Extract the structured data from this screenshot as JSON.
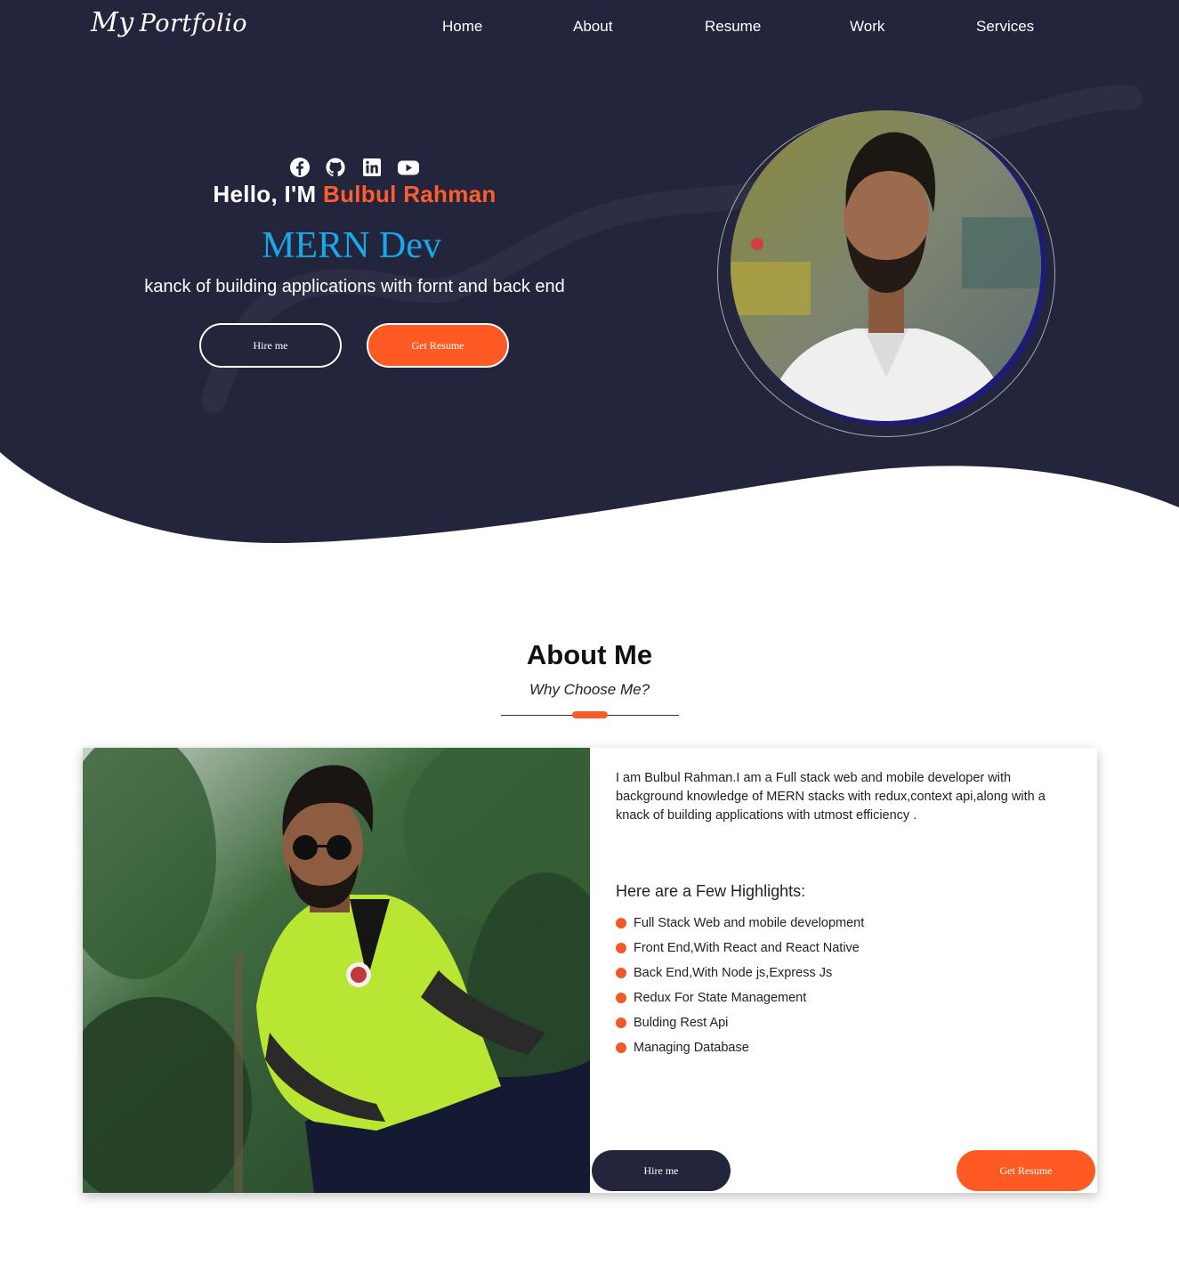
{
  "brand": {
    "logo_my": "My",
    "logo_rest": "Portfolio"
  },
  "nav": {
    "items": [
      "Home",
      "About",
      "Resume",
      "Work",
      "Services"
    ]
  },
  "colors": {
    "navy": "#23253d",
    "accent": "#ff5a24",
    "role_blue": "#1aa8e8"
  },
  "hero": {
    "social_icons": [
      "facebook-icon",
      "github-icon",
      "linkedin-icon",
      "youtube-icon"
    ],
    "greeting": "Hello, I'M",
    "name": "Bulbul Rahman",
    "role": "MERN Dev",
    "tagline": "kanck of building applications with fornt and back end",
    "hire_label": "Hire me",
    "resume_label": "Get Resume"
  },
  "about": {
    "title": "About Me",
    "subtitle": "Why Choose Me?",
    "bio": "I am Bulbul Rahman.I am a Full stack web and mobile developer with background knowledge of MERN stacks with redux,context api,along with a knack of building applications with utmost efficiency .",
    "highlights_title": "Here are a Few Highlights:",
    "highlights": [
      "Full Stack Web and mobile development",
      "Front End,With React and React Native",
      "Back End,With Node js,Express Js",
      "Redux For State Management",
      "Bulding Rest Api",
      "Managing Database"
    ],
    "hire_label": "Hire me",
    "resume_label": "Get Resume"
  }
}
